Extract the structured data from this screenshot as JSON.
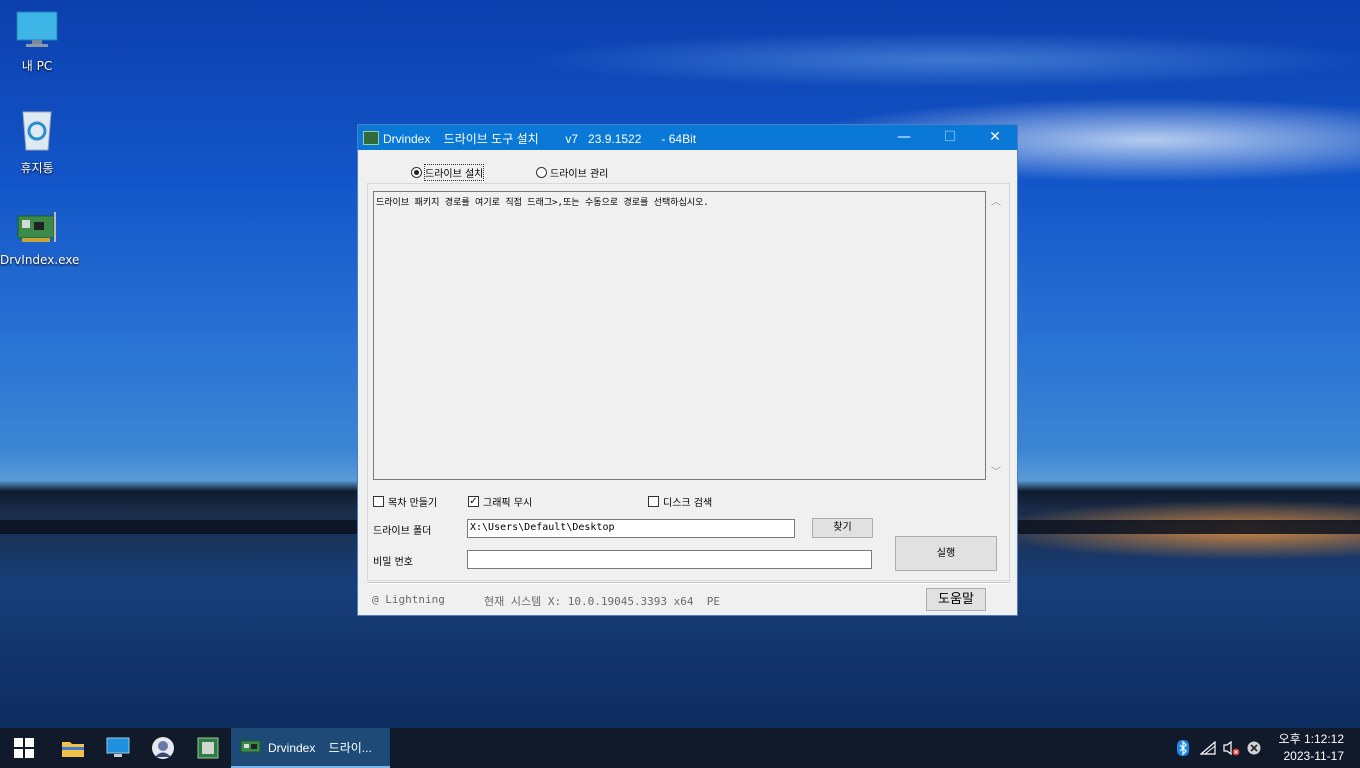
{
  "desktop": {
    "icons": [
      {
        "label": "내 PC",
        "icon": "computer-icon"
      },
      {
        "label": "휴지통",
        "icon": "recycle-bin-icon"
      },
      {
        "label": "DrvIndex.exe",
        "icon": "network-card-icon"
      }
    ]
  },
  "window": {
    "title": "Drvindex    드라이브 도구 설치        v7   23.9.1522      - 64Bit",
    "minimize": "—",
    "maximize": "☐",
    "close": "✕",
    "mode_options": [
      {
        "label": "드라이브 설치",
        "selected": true
      },
      {
        "label": "드라이브 관리",
        "selected": false
      }
    ],
    "log_text": "드라이브 패키지 경로를 여기로 직접 드래그>,또는 수동으로 경로를 선택하십시오.",
    "options": [
      {
        "label": "목차 만들기",
        "checked": false
      },
      {
        "label": "그래픽 무시",
        "checked": true
      },
      {
        "label": "디스크 검색",
        "checked": false
      }
    ],
    "folder_label": "드라이브 폴더",
    "folder_value": "X:\\Users\\Default\\Desktop",
    "browse_button": "찾기",
    "password_label": "비밀 번호",
    "password_value": "",
    "run_button": "실행",
    "footer_left": "@ Lightning",
    "footer_system": "현재 시스템 X: 10.0.19045.3393 x64  PE",
    "help_button": "도움말"
  },
  "taskbar": {
    "active_app_label": "Drvindex    드라이...",
    "clock_time": "오후 1:12:12",
    "clock_date": "2023-11-17",
    "tray_icons": [
      "bluetooth-icon",
      "network-icon",
      "volume-muted-icon",
      "close-circle-icon"
    ]
  }
}
